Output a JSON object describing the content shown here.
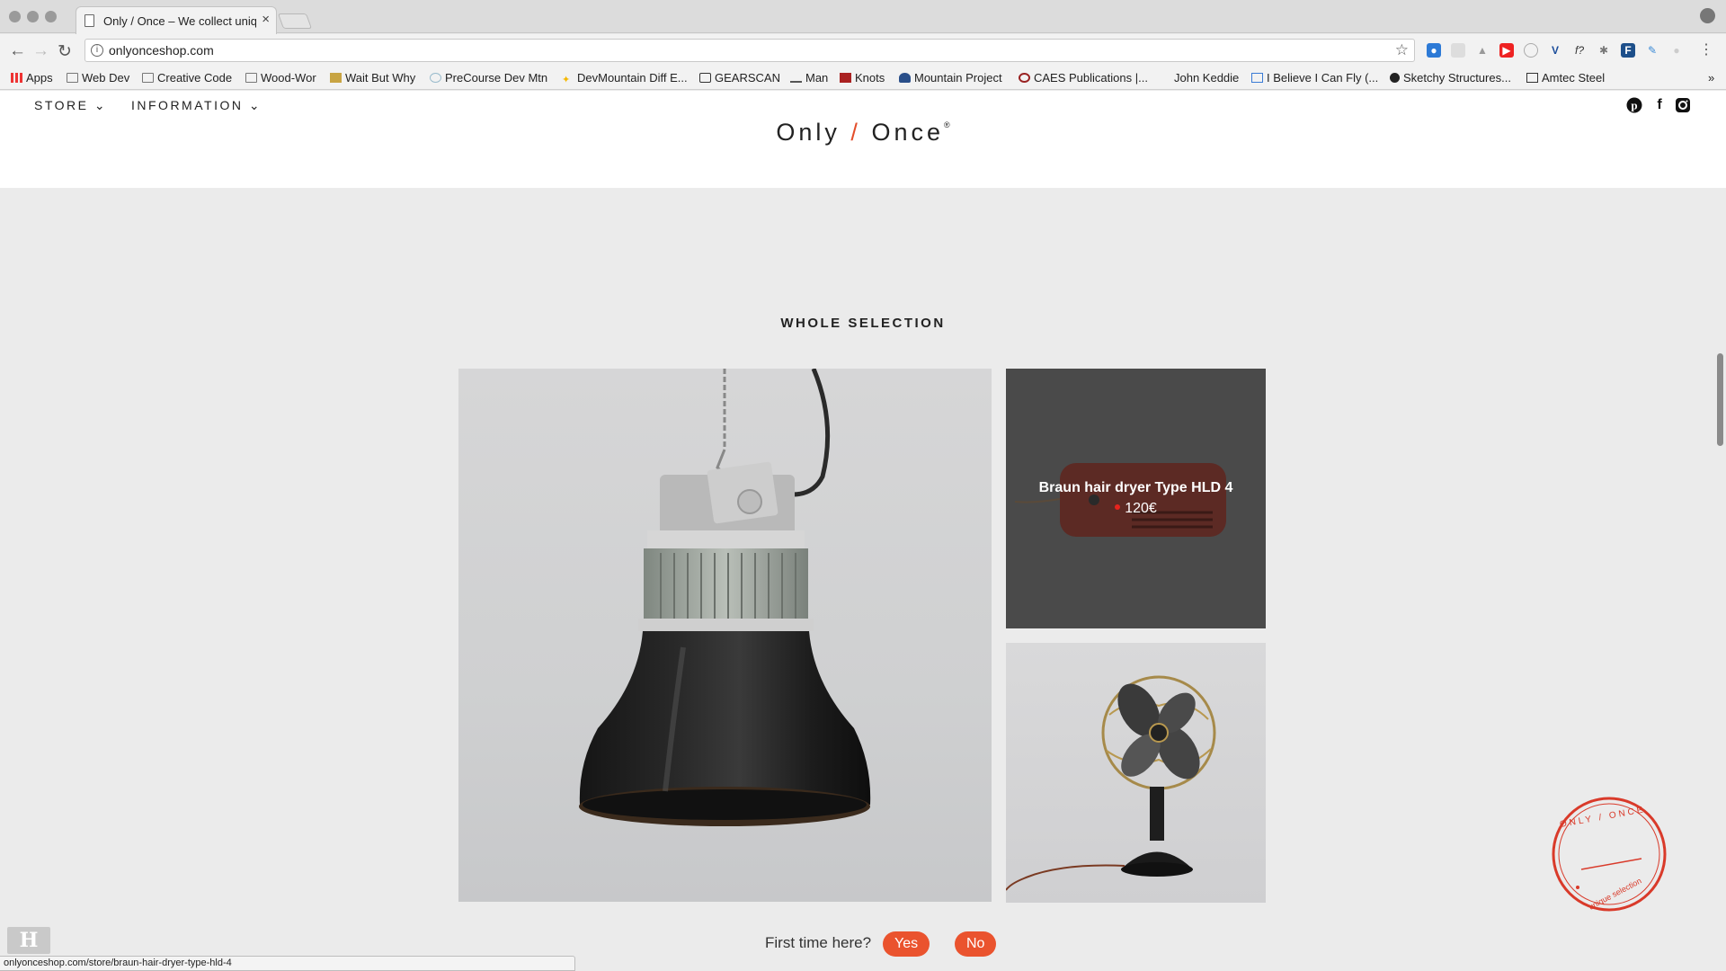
{
  "browser": {
    "tab_title": "Only / Once – We collect uniqu",
    "url": "onlyonceshop.com",
    "status_url": "onlyonceshop.com/store/braun-hair-dryer-type-hld-4",
    "bookmarks": [
      "Apps",
      "Web Dev",
      "Creative Code",
      "Wood-Wor",
      "Wait But Why",
      "PreCourse Dev Mtn",
      "DevMountain Diff E...",
      "GEARSCAN",
      "Man",
      "Knots",
      "Mountain Project",
      "CAES Publications |...",
      "John Keddie",
      "I Believe I Can Fly (...",
      "Sketchy Structures...",
      "Amtec Steel"
    ],
    "more_bookmarks": "»"
  },
  "site": {
    "nav": {
      "store": "STORE",
      "information": "INFORMATION",
      "chevron": "⌄"
    },
    "logo": {
      "left": "Only",
      "slash": "/",
      "right": "Once",
      "mark": "®"
    },
    "social": [
      "pinterest-icon",
      "facebook-icon",
      "instagram-icon"
    ],
    "section_title": "WHOLE SELECTION",
    "hover_product": {
      "name": "Braun hair dryer Type HLD 4",
      "price": "120€"
    },
    "stamp": {
      "top_text": "ONLY / ONCE",
      "bottom_text": "unique selection"
    },
    "first_time": {
      "question": "First time here?",
      "yes": "Yes",
      "no": "No"
    },
    "accent_color": "#ea532e"
  }
}
